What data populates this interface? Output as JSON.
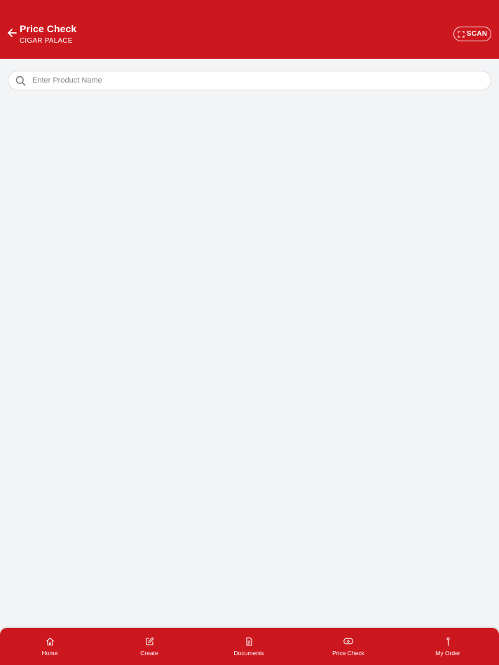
{
  "header": {
    "title": "Price Check",
    "subtitle": "CIGAR PALACE",
    "scan_label": "SCAN",
    "background": "#cd171e"
  },
  "search": {
    "placeholder": "Enter Product Name",
    "value": ""
  },
  "nav": {
    "items": [
      {
        "label": "Home",
        "icon": "home-icon"
      },
      {
        "label": "Create",
        "icon": "edit-icon"
      },
      {
        "label": "Documents",
        "icon": "document-icon"
      },
      {
        "label": "Price Check",
        "icon": "price-tag-icon"
      },
      {
        "label": "My Order",
        "icon": "pin-icon"
      }
    ]
  },
  "colors": {
    "accent": "#cd171e",
    "background": "#f3f4f6"
  }
}
